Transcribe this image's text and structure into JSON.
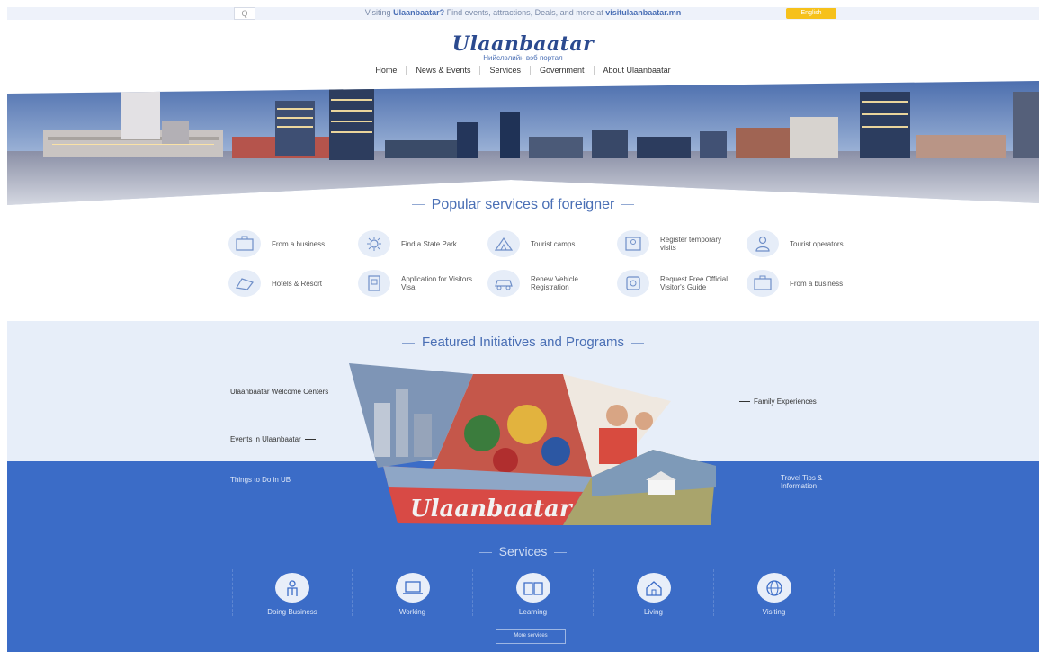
{
  "topbar": {
    "search_glyph": "Q",
    "message_prefix": "Visiting",
    "message_city": "Ulaanbaatar?",
    "message_body": "Find events, attractions, Deals, and more at",
    "message_site": "visitulaanbaatar.mn",
    "lang_button": "English"
  },
  "header": {
    "logo_text": "Ulaanbaatar",
    "tagline": "Нийслэлийн вэб портал",
    "nav": [
      "Home",
      "News & Events",
      "Services",
      "Government",
      "About Ulaanbaatar"
    ]
  },
  "popular": {
    "title": "Popular services of foreigner",
    "items": [
      {
        "label": "From a business",
        "icon": "briefcase-icon"
      },
      {
        "label": "Find a State Park",
        "icon": "sun-icon"
      },
      {
        "label": "Tourist camps",
        "icon": "camp-icon"
      },
      {
        "label": "Register temporary visits",
        "icon": "id-card-icon"
      },
      {
        "label": "Tourist operators",
        "icon": "person-icon"
      },
      {
        "label": "Hotels & Resort",
        "icon": "bed-icon"
      },
      {
        "label": "Application for Visitors Visa",
        "icon": "document-icon"
      },
      {
        "label": "Renew Vehicle Registration",
        "icon": "car-icon"
      },
      {
        "label": "Request Free Official Visitor's Guide",
        "icon": "guide-icon"
      },
      {
        "label": "From a business",
        "icon": "briefcase-icon"
      }
    ]
  },
  "featured": {
    "title": "Featured Initiatives and Programs",
    "links": {
      "welcome": "Ulaanbaatar Welcome Centers",
      "events": "Events in Ulaanbaatar",
      "things": "Things to Do in UB",
      "family": "Family Experiences",
      "travel": "Travel Tips & Information"
    },
    "collage_sign": "Ulaanbaatar"
  },
  "services": {
    "title": "Services",
    "items": [
      {
        "label": "Doing Business",
        "icon": "businessman-icon"
      },
      {
        "label": "Working",
        "icon": "laptop-icon"
      },
      {
        "label": "Learning",
        "icon": "book-icon"
      },
      {
        "label": "Living",
        "icon": "house-icon"
      },
      {
        "label": "Visiting",
        "icon": "globe-icon"
      }
    ],
    "more_button": "More services"
  },
  "colors": {
    "brand_blue": "#3b6cc7",
    "light_blue": "#e7eef9",
    "accent_yellow": "#f6c11b",
    "title_blue": "#4a6fb5"
  }
}
